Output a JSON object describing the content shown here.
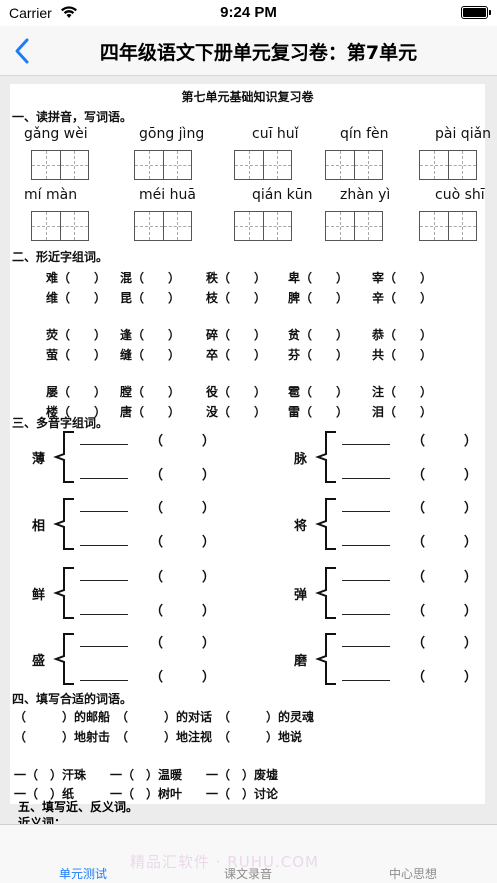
{
  "status_bar": {
    "carrier": "Carrier",
    "time": "9:24 PM"
  },
  "nav": {
    "title": "四年级语文下册单元复习卷：第7单元"
  },
  "paper": {
    "title": "第七单元基础知识复习卷",
    "sections": {
      "s1": "一、读拼音，写词语。",
      "s2": "二、形近字组词。",
      "s3": "三、多音字组词。",
      "s4": "四、填写合适的词语。",
      "s5": "五、填写近、反义词。",
      "s5_sub": "近义词："
    },
    "pinyin": [
      [
        "gǎng wèi",
        "gōng jìng",
        "cuī huǐ",
        "qín fèn",
        "pài qiǎn"
      ],
      [
        "mí màn",
        "méi huā",
        "qián kūn",
        "zhàn yì",
        "cuò shī"
      ]
    ],
    "similar": [
      [
        "难（　　）",
        "混（　　）",
        "秩（　　）",
        "卑（　　）",
        "宰（　　）"
      ],
      [
        "维（　　）",
        "昆（　　）",
        "枝（　　）",
        "脾（　　）",
        "辛（　　）"
      ],
      [
        "荧（　　）",
        "逢（　　）",
        "碎（　　）",
        "贫（　　）",
        "恭（　　）"
      ],
      [
        "萤（　　）",
        "缝（　　）",
        "卒（　　）",
        "芬（　　）",
        "共（　　）"
      ],
      [
        "屡（　　）",
        "膛（　　）",
        "役（　　）",
        "雹（　　）",
        "注（　　）"
      ],
      [
        "楼（　　）",
        "唐（　　）",
        "没（　　）",
        "雷（　　）",
        "泪（　　）"
      ]
    ],
    "polyphones": [
      "薄",
      "脉",
      "相",
      "将",
      "鲜",
      "弹",
      "盛",
      "磨"
    ],
    "paren": "（　　　）",
    "fill_lines": [
      "（　　　）的邮船　（　　　）的对话　（　　　）的灵魂",
      "（　　　）地射击　（　　　）地注视　（　　　）地说",
      "一（　）汗珠　　一（　）温暖　　一（　）废墟",
      "一（　）纸　　　一（　）树叶　　一（　）讨论"
    ]
  },
  "tabs": [
    {
      "label": "单元测试",
      "active": true
    },
    {
      "label": "课文录音",
      "active": false
    },
    {
      "label": "中心思想",
      "active": false
    }
  ],
  "watermark": "精品汇软件 · RUHU.COM",
  "colors": {
    "accent": "#1e7cf5",
    "inactive": "#8c8c8c"
  }
}
